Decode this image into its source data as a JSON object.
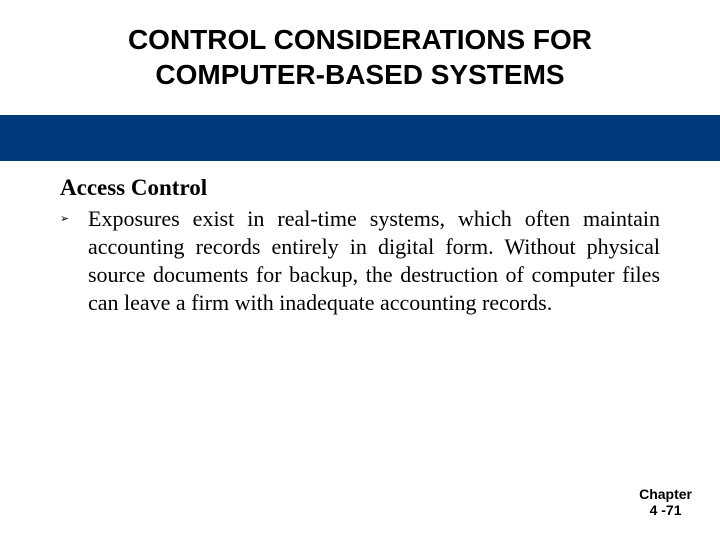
{
  "title_line1": "CONTROL CONSIDERATIONS FOR",
  "title_line2": "COMPUTER-BASED SYSTEMS",
  "section_heading": "Access Control",
  "bullet_marker": "➢",
  "bullet_text": "Exposures exist in real-time systems, which often maintain accounting records entirely in digital form. Without physical source documents for backup, the destruction of computer files can leave a firm with inadequate accounting records.",
  "footer_line1": "Chapter",
  "footer_line2": "4 -71"
}
